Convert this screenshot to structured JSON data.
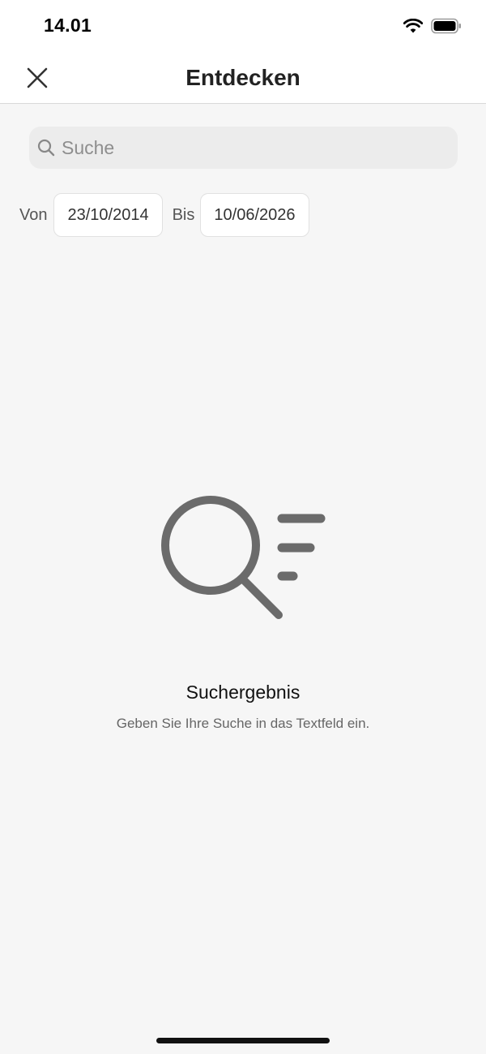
{
  "status_bar": {
    "time": "14.01",
    "icons": [
      "wifi-icon",
      "battery-icon"
    ]
  },
  "header": {
    "title": "Entdecken",
    "close_icon": "close-icon"
  },
  "search": {
    "placeholder": "Suche",
    "value": "",
    "icon": "search-icon"
  },
  "date_range": {
    "from_label": "Von",
    "from_value": "23/10/2014",
    "to_label": "Bis",
    "to_value": "10/06/2026"
  },
  "empty_state": {
    "icon": "search-results-icon",
    "title": "Suchergebnis",
    "subtitle": "Geben Sie Ihre Suche in das Textfeld ein."
  },
  "colors": {
    "background": "#f6f6f6",
    "header_background": "#ffffff",
    "search_background": "#ececec",
    "illustration": "#6b6b6b"
  }
}
